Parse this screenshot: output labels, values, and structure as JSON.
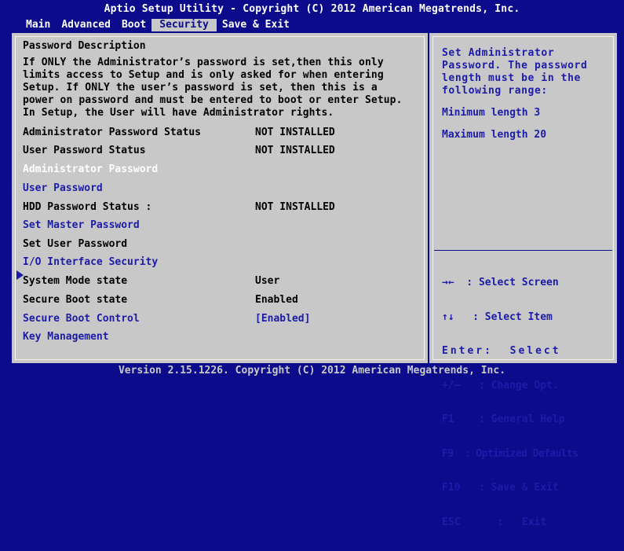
{
  "header": {
    "title": "Aptio Setup Utility - Copyright (C) 2012 American Megatrends, Inc.",
    "tabs": [
      {
        "label": "Main"
      },
      {
        "label": "Advanced"
      },
      {
        "label": "Boot"
      },
      {
        "label": "Security",
        "active": true
      },
      {
        "label": "Save & Exit"
      }
    ]
  },
  "left": {
    "desc_title": "Password Description",
    "desc_lines": [
      "If ONLY the Administrator’s password is set,then this only",
      "limits access to Setup and is only asked for when entering",
      "Setup. If ONLY the user’s password is set, then this is a",
      "power on password and must be entered to boot or enter Setup.",
      "In Setup, the User will have Administrator rights."
    ],
    "items": [
      {
        "label": "Administrator Password Status",
        "value": "NOT INSTALLED"
      },
      {
        "label": "User Password Status",
        "value": "NOT INSTALLED"
      },
      {
        "label": "Administrator Password"
      },
      {
        "label": "User Password"
      },
      {
        "label": "HDD Password Status :",
        "value": "NOT INSTALLED"
      },
      {
        "label": "Set Master Password"
      },
      {
        "label": "Set User Password"
      },
      {
        "label": "I/O Interface Security"
      },
      {
        "label": "System Mode state",
        "value": "User"
      },
      {
        "label": "Secure Boot state",
        "value": "Enabled"
      },
      {
        "label": "Secure Boot Control",
        "value": "[Enabled]"
      },
      {
        "label": "Key Management"
      }
    ]
  },
  "help": {
    "text": "Set Administrator Password. The password length must be in the following range:",
    "min": "Minimum length 3",
    "max": "Maximum length 20"
  },
  "keys": [
    "→←  : Select Screen",
    "↑↓   : Select Item",
    "Enter:  Select",
    "+/—   : Change Opt.",
    "F1    : General Help",
    "F9  : Optimized Defaults",
    "F10   : Save & Exit",
    "ESC      :   Exit"
  ],
  "footer": "Version 2.15.1226. Copyright (C) 2012 American Megatrends, Inc.",
  "colors": {
    "background": "#0b0b8c",
    "panel": "#c8c8c8",
    "link": "#1c1ca8",
    "selected": "#ffffff"
  }
}
